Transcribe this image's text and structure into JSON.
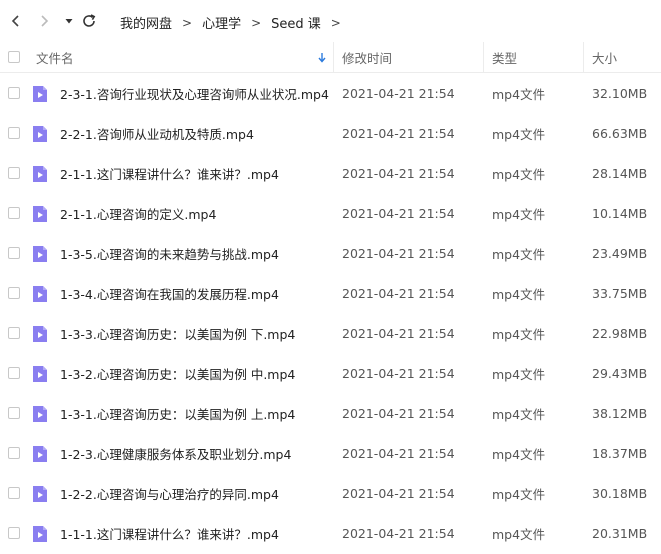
{
  "breadcrumb": [
    "我的网盘",
    "心理学",
    "Seed 课"
  ],
  "columns": {
    "name": "文件名",
    "modified": "修改时间",
    "type": "类型",
    "size": "大小"
  },
  "files": [
    {
      "name": "2-3-1.咨询行业现状及心理咨询师从业状况.mp4",
      "modified": "2021-04-21 21:54",
      "type": "mp4文件",
      "size": "32.10MB"
    },
    {
      "name": "2-2-1.咨询师从业动机及特质.mp4",
      "modified": "2021-04-21 21:54",
      "type": "mp4文件",
      "size": "66.63MB"
    },
    {
      "name": "2-1-1.这门课程讲什么？谁来讲？.mp4",
      "modified": "2021-04-21 21:54",
      "type": "mp4文件",
      "size": "28.14MB"
    },
    {
      "name": "2-1-1.心理咨询的定义.mp4",
      "modified": "2021-04-21 21:54",
      "type": "mp4文件",
      "size": "10.14MB"
    },
    {
      "name": "1-3-5.心理咨询的未来趋势与挑战.mp4",
      "modified": "2021-04-21 21:54",
      "type": "mp4文件",
      "size": "23.49MB"
    },
    {
      "name": "1-3-4.心理咨询在我国的发展历程.mp4",
      "modified": "2021-04-21 21:54",
      "type": "mp4文件",
      "size": "33.75MB"
    },
    {
      "name": "1-3-3.心理咨询历史：以美国为例 下.mp4",
      "modified": "2021-04-21 21:54",
      "type": "mp4文件",
      "size": "22.98MB"
    },
    {
      "name": "1-3-2.心理咨询历史：以美国为例 中.mp4",
      "modified": "2021-04-21 21:54",
      "type": "mp4文件",
      "size": "29.43MB"
    },
    {
      "name": "1-3-1.心理咨询历史：以美国为例 上.mp4",
      "modified": "2021-04-21 21:54",
      "type": "mp4文件",
      "size": "38.12MB"
    },
    {
      "name": "1-2-3.心理健康服务体系及职业划分.mp4",
      "modified": "2021-04-21 21:54",
      "type": "mp4文件",
      "size": "18.37MB"
    },
    {
      "name": "1-2-2.心理咨询与心理治疗的异同.mp4",
      "modified": "2021-04-21 21:54",
      "type": "mp4文件",
      "size": "30.18MB"
    },
    {
      "name": "1-1-1.这门课程讲什么？谁来讲？.mp4",
      "modified": "2021-04-21 21:54",
      "type": "mp4文件",
      "size": "20.31MB"
    }
  ],
  "colors": {
    "accent": "#2c7bdd",
    "video_icon": "#8a7ef0"
  },
  "icons": {
    "back": "chevron-left-icon",
    "forward": "chevron-right-icon",
    "dropdown": "caret-down-icon",
    "refresh": "refresh-icon",
    "sort": "sort-down-arrow-icon",
    "file": "video-file-icon"
  }
}
